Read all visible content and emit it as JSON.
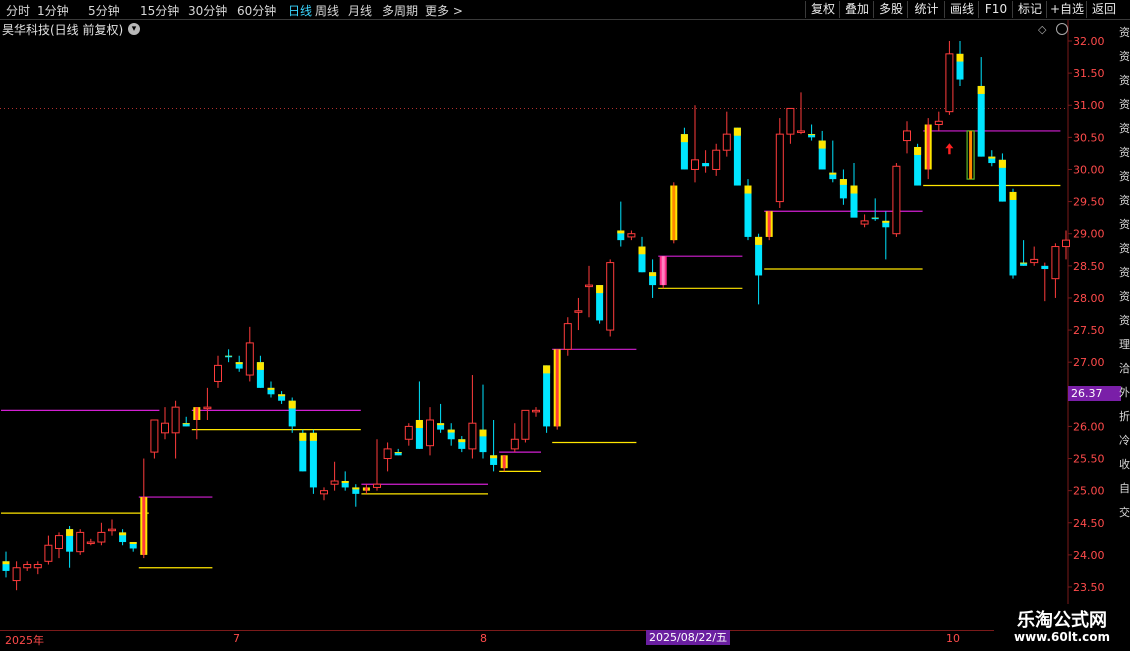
{
  "toolbar": {
    "timeframes": [
      "分时",
      "1分钟",
      "5分钟",
      "15分钟",
      "30分钟",
      "60分钟",
      "日线",
      "周线",
      "月线",
      "多周期",
      "更多"
    ],
    "active_timeframe": "日线",
    "right_buttons": [
      "复权",
      "叠加",
      "多股",
      "统计",
      "画线",
      "F10",
      "标记",
      "+自选",
      "返回"
    ]
  },
  "stock": {
    "title": "昊华科技(日线 前复权)"
  },
  "price_axis": {
    "labels": [
      "32.00",
      "31.50",
      "31.00",
      "30.50",
      "30.00",
      "29.50",
      "29.00",
      "28.50",
      "28.00",
      "27.50",
      "27.00",
      "26.50",
      "26.00",
      "25.50",
      "25.00",
      "24.50",
      "24.00",
      "23.50"
    ],
    "current_price": "26.37"
  },
  "date_axis": {
    "labels": [
      "2025年",
      "7",
      "8",
      "10"
    ],
    "selected_date": "2025/08/22/五"
  },
  "right_strip": [
    "资",
    "资",
    "资",
    "资",
    "资",
    "资",
    "资",
    "资",
    "资",
    "资",
    "资",
    "资",
    "资",
    "理",
    "洽",
    "外",
    "折",
    "冷",
    "收",
    "自",
    "交"
  ],
  "watermark": {
    "title": "乐淘公式网",
    "url": "www.60lt.com"
  },
  "colors": {
    "up": "#ff3c3c",
    "down": "#00e5ff",
    "yellow": "#ffe600",
    "magenta": "#d21fd2",
    "orange": "#ff8a00",
    "pink": "#ff2d8a",
    "axis": "#ff4b4b"
  },
  "chart_data": {
    "type": "candlestick",
    "ylim": [
      23.3,
      32.2
    ],
    "candles": [
      {
        "o": 23.9,
        "h": 24.05,
        "l": 23.65,
        "c": 23.75,
        "hl": "cyan"
      },
      {
        "o": 23.6,
        "h": 23.9,
        "l": 23.45,
        "c": 23.8
      },
      {
        "o": 23.8,
        "h": 23.9,
        "l": 23.75,
        "c": 23.85
      },
      {
        "o": 23.8,
        "h": 23.9,
        "l": 23.7,
        "c": 23.85
      },
      {
        "o": 23.9,
        "h": 24.3,
        "l": 23.85,
        "c": 24.15
      },
      {
        "o": 24.1,
        "h": 24.35,
        "l": 23.95,
        "c": 24.3
      },
      {
        "o": 24.4,
        "h": 24.45,
        "l": 23.8,
        "c": 24.05,
        "hl": "cyan"
      },
      {
        "o": 24.05,
        "h": 24.4,
        "l": 24.0,
        "c": 24.35
      },
      {
        "o": 24.2,
        "h": 24.25,
        "l": 24.15,
        "c": 24.2
      },
      {
        "o": 24.2,
        "h": 24.5,
        "l": 24.15,
        "c": 24.35
      },
      {
        "o": 24.4,
        "h": 24.55,
        "l": 24.3,
        "c": 24.4
      },
      {
        "o": 24.35,
        "h": 24.4,
        "l": 24.15,
        "c": 24.2,
        "hl": "cyan"
      },
      {
        "o": 24.2,
        "h": 24.2,
        "l": 24.05,
        "c": 24.1,
        "hl": "cyan"
      },
      {
        "o": 24.0,
        "h": 25.5,
        "l": 23.95,
        "c": 24.9,
        "hl": "stripe"
      },
      {
        "o": 25.6,
        "h": 26.0,
        "l": 25.5,
        "c": 26.1
      },
      {
        "o": 25.9,
        "h": 26.3,
        "l": 25.8,
        "c": 26.05
      },
      {
        "o": 25.9,
        "h": 26.4,
        "l": 25.5,
        "c": 26.3
      },
      {
        "o": 26.05,
        "h": 26.15,
        "l": 26.0,
        "c": 26.0,
        "hl": "cyan"
      },
      {
        "o": 26.1,
        "h": 26.3,
        "l": 25.8,
        "c": 26.3,
        "hl": "stripe"
      },
      {
        "o": 26.3,
        "h": 26.6,
        "l": 26.1,
        "c": 26.3
      },
      {
        "o": 26.7,
        "h": 27.1,
        "l": 26.6,
        "c": 26.95
      },
      {
        "o": 27.1,
        "h": 27.2,
        "l": 27.0,
        "c": 27.1,
        "hl": "cyan"
      },
      {
        "o": 27.0,
        "h": 27.1,
        "l": 26.85,
        "c": 26.9,
        "hl": "cyan"
      },
      {
        "o": 26.8,
        "h": 27.55,
        "l": 26.7,
        "c": 27.3
      },
      {
        "o": 27.0,
        "h": 27.1,
        "l": 26.6,
        "c": 26.6,
        "hl": "cyan"
      },
      {
        "o": 26.6,
        "h": 26.7,
        "l": 26.45,
        "c": 26.5,
        "hl": "cyan"
      },
      {
        "o": 26.5,
        "h": 26.55,
        "l": 26.35,
        "c": 26.4,
        "hl": "cyan"
      },
      {
        "o": 26.4,
        "h": 26.45,
        "l": 25.9,
        "c": 26.0,
        "hl": "cyan"
      },
      {
        "o": 25.9,
        "h": 25.95,
        "l": 25.3,
        "c": 25.3,
        "hl": "cyan"
      },
      {
        "o": 25.9,
        "h": 25.95,
        "l": 24.95,
        "c": 25.05,
        "hl": "cyan"
      },
      {
        "o": 24.95,
        "h": 25.05,
        "l": 24.85,
        "c": 25.0
      },
      {
        "o": 25.1,
        "h": 25.45,
        "l": 25.0,
        "c": 25.15
      },
      {
        "o": 25.15,
        "h": 25.3,
        "l": 25.0,
        "c": 25.05,
        "hl": "cyan"
      },
      {
        "o": 25.05,
        "h": 25.1,
        "l": 24.75,
        "c": 24.95,
        "hl": "cyan"
      },
      {
        "o": 25.0,
        "h": 25.1,
        "l": 24.95,
        "c": 25.05,
        "hl": "stripe"
      },
      {
        "o": 25.05,
        "h": 25.8,
        "l": 25.0,
        "c": 25.1
      },
      {
        "o": 25.5,
        "h": 25.75,
        "l": 25.3,
        "c": 25.65
      },
      {
        "o": 25.6,
        "h": 25.65,
        "l": 25.55,
        "c": 25.55,
        "hl": "cyan"
      },
      {
        "o": 25.8,
        "h": 26.05,
        "l": 25.7,
        "c": 26.0
      },
      {
        "o": 26.1,
        "h": 26.7,
        "l": 25.65,
        "c": 25.65,
        "hl": "cyan"
      },
      {
        "o": 25.7,
        "h": 26.3,
        "l": 25.55,
        "c": 26.1
      },
      {
        "o": 26.05,
        "h": 26.35,
        "l": 25.9,
        "c": 25.95,
        "hl": "cyan"
      },
      {
        "o": 25.95,
        "h": 26.05,
        "l": 25.7,
        "c": 25.8,
        "hl": "cyan"
      },
      {
        "o": 25.8,
        "h": 25.85,
        "l": 25.6,
        "c": 25.65,
        "hl": "cyan"
      },
      {
        "o": 25.65,
        "h": 26.8,
        "l": 25.5,
        "c": 26.05
      },
      {
        "o": 25.95,
        "h": 26.65,
        "l": 25.5,
        "c": 25.6,
        "hl": "cyan"
      },
      {
        "o": 25.55,
        "h": 26.1,
        "l": 25.3,
        "c": 25.4,
        "hl": "cyan"
      },
      {
        "o": 25.35,
        "h": 25.55,
        "l": 25.3,
        "c": 25.55,
        "hl": "stripe"
      },
      {
        "o": 25.65,
        "h": 26.05,
        "l": 25.6,
        "c": 25.8
      },
      {
        "o": 25.8,
        "h": 26.25,
        "l": 25.75,
        "c": 26.25
      },
      {
        "o": 26.25,
        "h": 26.3,
        "l": 26.15,
        "c": 26.25
      },
      {
        "o": 26.95,
        "h": 26.95,
        "l": 25.9,
        "c": 26.0,
        "hl": "cyan"
      },
      {
        "o": 26.0,
        "h": 27.2,
        "l": 25.95,
        "c": 27.2,
        "hl": "stripe"
      },
      {
        "o": 27.2,
        "h": 27.7,
        "l": 27.1,
        "c": 27.6
      },
      {
        "o": 27.8,
        "h": 28.0,
        "l": 27.5,
        "c": 27.8
      },
      {
        "o": 28.2,
        "h": 28.5,
        "l": 27.7,
        "c": 28.2
      },
      {
        "o": 28.2,
        "h": 28.2,
        "l": 27.6,
        "c": 27.65,
        "hl": "cyan"
      },
      {
        "o": 27.5,
        "h": 28.6,
        "l": 27.4,
        "c": 28.55
      },
      {
        "o": 28.9,
        "h": 29.5,
        "l": 28.8,
        "c": 29.05,
        "hl": "cyan"
      },
      {
        "o": 28.95,
        "h": 29.05,
        "l": 28.9,
        "c": 29.0
      },
      {
        "o": 28.8,
        "h": 28.95,
        "l": 28.4,
        "c": 28.4,
        "hl": "cyan"
      },
      {
        "o": 28.4,
        "h": 28.6,
        "l": 28.0,
        "c": 28.2,
        "hl": "cyan"
      },
      {
        "o": 28.2,
        "h": 28.65,
        "l": 28.15,
        "c": 28.65,
        "hl": "pink"
      },
      {
        "o": 28.9,
        "h": 29.8,
        "l": 28.85,
        "c": 29.75,
        "hl": "orange"
      },
      {
        "o": 30.55,
        "h": 30.65,
        "l": 30.0,
        "c": 30.0,
        "hl": "cyan"
      },
      {
        "o": 30.0,
        "h": 31.0,
        "l": 29.8,
        "c": 30.15
      },
      {
        "o": 30.1,
        "h": 30.3,
        "l": 29.95,
        "c": 30.05
      },
      {
        "o": 30.0,
        "h": 30.4,
        "l": 29.9,
        "c": 30.3
      },
      {
        "o": 30.3,
        "h": 30.9,
        "l": 30.2,
        "c": 30.55
      },
      {
        "o": 30.65,
        "h": 30.65,
        "l": 29.75,
        "c": 29.75,
        "hl": "cyan"
      },
      {
        "o": 29.75,
        "h": 29.85,
        "l": 28.9,
        "c": 28.95,
        "hl": "cyan"
      },
      {
        "o": 28.95,
        "h": 29.0,
        "l": 27.9,
        "c": 28.35,
        "hl": "cyan"
      },
      {
        "o": 28.95,
        "h": 29.35,
        "l": 28.9,
        "c": 29.35,
        "hl": "stripe"
      },
      {
        "o": 29.5,
        "h": 30.8,
        "l": 29.4,
        "c": 30.55
      },
      {
        "o": 30.55,
        "h": 30.95,
        "l": 30.4,
        "c": 30.95
      },
      {
        "o": 30.6,
        "h": 31.2,
        "l": 30.55,
        "c": 30.6
      },
      {
        "o": 30.55,
        "h": 30.7,
        "l": 30.45,
        "c": 30.5,
        "hl": "cyan"
      },
      {
        "o": 30.45,
        "h": 30.6,
        "l": 30.0,
        "c": 30.0,
        "hl": "cyan"
      },
      {
        "o": 29.95,
        "h": 30.45,
        "l": 29.8,
        "c": 29.85,
        "hl": "cyan"
      },
      {
        "o": 29.85,
        "h": 30.0,
        "l": 29.45,
        "c": 29.55,
        "hl": "cyan"
      },
      {
        "o": 29.75,
        "h": 30.1,
        "l": 29.35,
        "c": 29.25,
        "hl": "cyan"
      },
      {
        "o": 29.15,
        "h": 29.3,
        "l": 29.1,
        "c": 29.2
      },
      {
        "o": 29.25,
        "h": 29.55,
        "l": 29.2,
        "c": 29.25,
        "hl": "cyan"
      },
      {
        "o": 29.2,
        "h": 29.35,
        "l": 28.6,
        "c": 29.1,
        "hl": "cyan"
      },
      {
        "o": 29.0,
        "h": 30.1,
        "l": 28.95,
        "c": 30.05
      },
      {
        "o": 30.45,
        "h": 30.75,
        "l": 30.25,
        "c": 30.6
      },
      {
        "o": 30.35,
        "h": 30.4,
        "l": 29.75,
        "c": 29.75,
        "hl": "cyan"
      },
      {
        "o": 30.0,
        "h": 30.8,
        "l": 29.85,
        "c": 30.7,
        "hl": "stripe"
      },
      {
        "o": 30.7,
        "h": 30.9,
        "l": 30.6,
        "c": 30.75
      },
      {
        "o": 30.9,
        "h": 32.0,
        "l": 30.85,
        "c": 31.8
      },
      {
        "o": 31.8,
        "h": 32.0,
        "l": 31.3,
        "c": 31.4,
        "hl": "cyan"
      },
      {
        "o": 30.6,
        "h": 30.6,
        "l": 29.85,
        "c": 29.85,
        "hl": "green"
      },
      {
        "o": 31.3,
        "h": 31.75,
        "l": 30.2,
        "c": 30.2,
        "hl": "cyan"
      },
      {
        "o": 30.2,
        "h": 30.3,
        "l": 30.05,
        "c": 30.1,
        "hl": "cyan"
      },
      {
        "o": 30.15,
        "h": 30.25,
        "l": 29.5,
        "c": 29.5,
        "hl": "cyan"
      },
      {
        "o": 29.65,
        "h": 29.7,
        "l": 28.3,
        "c": 28.35,
        "hl": "cyan"
      },
      {
        "o": 28.55,
        "h": 28.9,
        "l": 28.5,
        "c": 28.5,
        "hl": "cyan"
      },
      {
        "o": 28.55,
        "h": 28.8,
        "l": 28.5,
        "c": 28.6
      },
      {
        "o": 28.5,
        "h": 28.55,
        "l": 27.95,
        "c": 28.45
      },
      {
        "o": 28.3,
        "h": 28.85,
        "l": 28.0,
        "c": 28.8
      },
      {
        "o": 28.8,
        "h": 29.05,
        "l": 28.6,
        "c": 28.9
      }
    ],
    "support_lines": [
      {
        "price": 26.25,
        "i0": 0,
        "i1": 14,
        "color": "magenta"
      },
      {
        "price": 24.65,
        "i0": 0,
        "i1": 13,
        "color": "yellow"
      },
      {
        "price": 24.9,
        "i0": 13,
        "i1": 19,
        "color": "magenta"
      },
      {
        "price": 23.8,
        "i0": 13,
        "i1": 19,
        "color": "yellow"
      },
      {
        "price": 26.25,
        "i0": 18,
        "i1": 33,
        "color": "magenta"
      },
      {
        "price": 25.95,
        "i0": 18,
        "i1": 33,
        "color": "yellow"
      },
      {
        "price": 25.1,
        "i0": 34,
        "i1": 45,
        "color": "magenta"
      },
      {
        "price": 24.95,
        "i0": 34,
        "i1": 45,
        "color": "yellow"
      },
      {
        "price": 25.6,
        "i0": 47,
        "i1": 50,
        "color": "magenta"
      },
      {
        "price": 25.3,
        "i0": 47,
        "i1": 50,
        "color": "yellow"
      },
      {
        "price": 27.2,
        "i0": 52,
        "i1": 59,
        "color": "magenta"
      },
      {
        "price": 25.75,
        "i0": 52,
        "i1": 59,
        "color": "yellow"
      },
      {
        "price": 28.65,
        "i0": 62,
        "i1": 69,
        "color": "magenta"
      },
      {
        "price": 28.15,
        "i0": 62,
        "i1": 69,
        "color": "yellow"
      },
      {
        "price": 29.35,
        "i0": 72,
        "i1": 86,
        "color": "magenta"
      },
      {
        "price": 28.45,
        "i0": 72,
        "i1": 86,
        "color": "yellow"
      },
      {
        "price": 30.6,
        "i0": 87,
        "i1": 99,
        "color": "magenta"
      },
      {
        "price": 29.75,
        "i0": 87,
        "i1": 99,
        "color": "yellow"
      }
    ],
    "markers": [
      {
        "i": 89,
        "price": 30.3,
        "symbol": "up-arrow"
      }
    ],
    "reference_price": 30.95
  }
}
